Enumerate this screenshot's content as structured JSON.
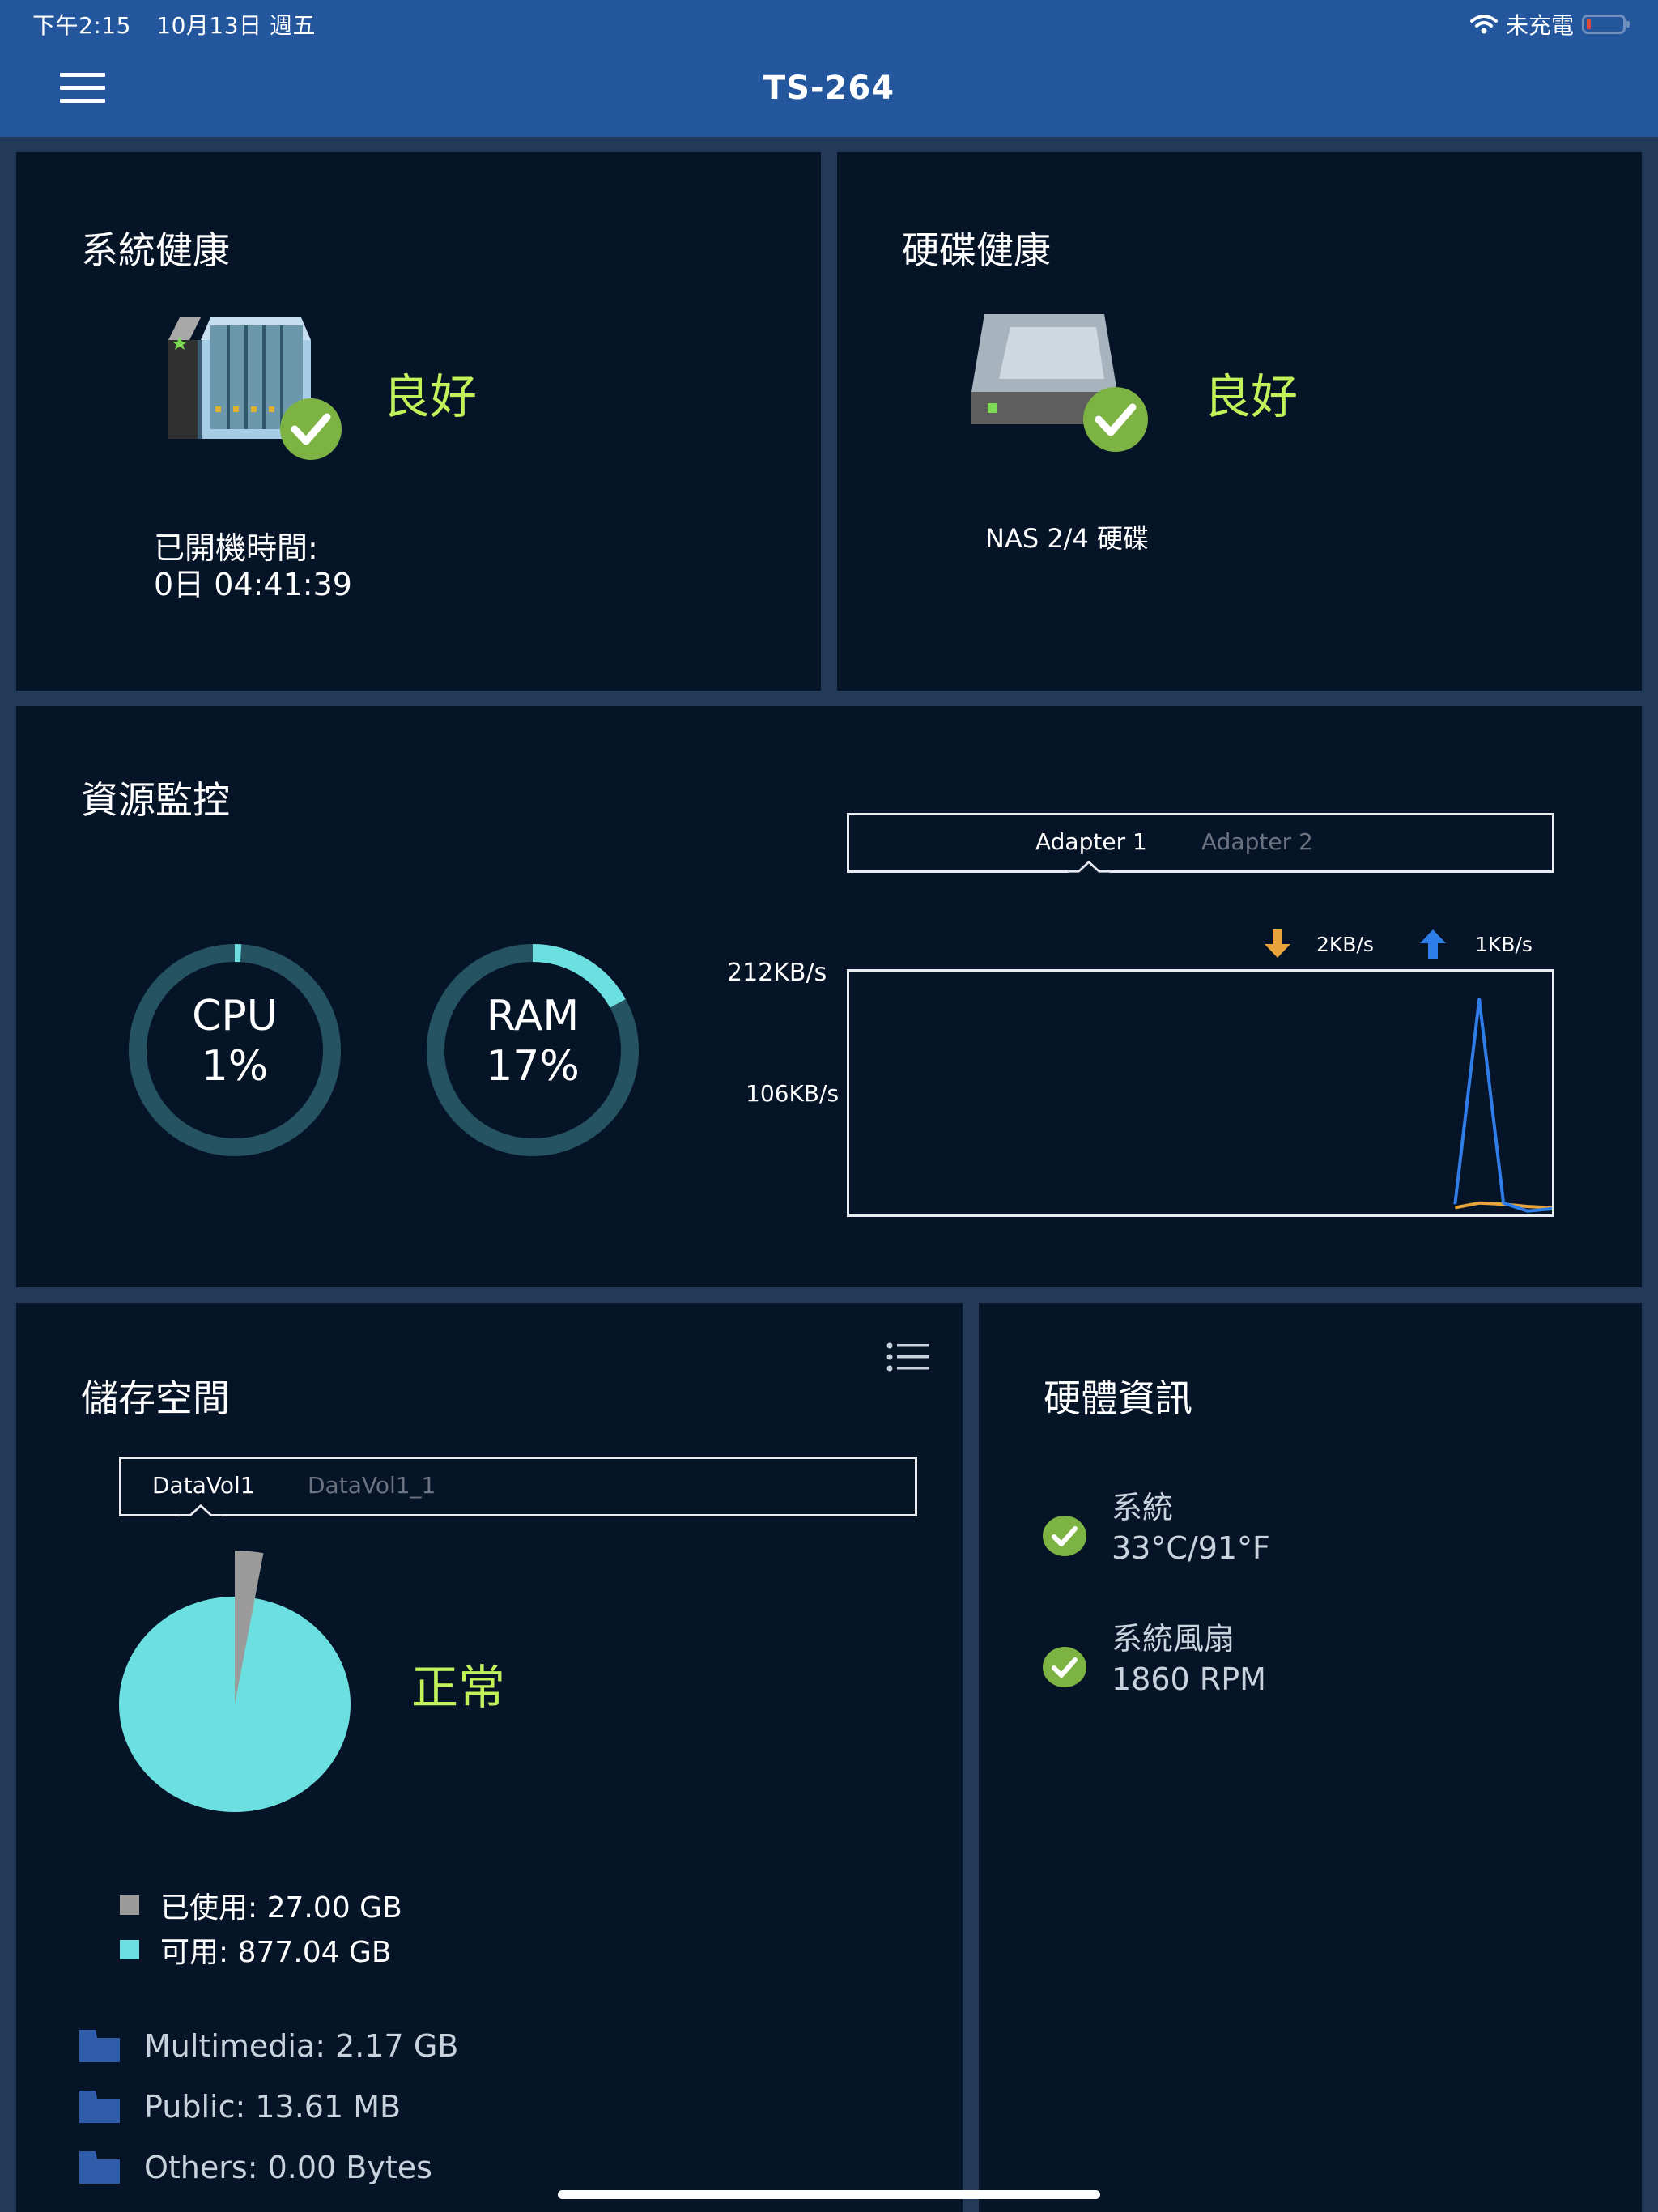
{
  "status_bar": {
    "time": "下午2:15",
    "date": "10月13日 週五",
    "charging_status": "未充電",
    "icons": [
      "wifi-icon",
      "battery-icon"
    ]
  },
  "header": {
    "title": "TS-264",
    "menu_icon": "hamburger-menu-icon"
  },
  "system_health": {
    "title": "系統健康",
    "status": "良好",
    "uptime_label": "已開機時間:",
    "uptime_value": "0日 04:41:39",
    "icon": "nas-device-icon"
  },
  "disk_health": {
    "title": "硬碟健康",
    "status": "良好",
    "disk_count": "NAS 2/4 硬碟",
    "icon": "hard-drive-icon"
  },
  "resource_monitor": {
    "title": "資源監控",
    "cpu": {
      "label": "CPU",
      "value_text": "1%",
      "percent": 1
    },
    "ram": {
      "label": "RAM",
      "value_text": "17%",
      "percent": 17
    },
    "adapter_tabs": [
      {
        "label": "Adapter 1",
        "active": true
      },
      {
        "label": "Adapter 2",
        "active": false
      }
    ],
    "download_rate": "2KB/s",
    "upload_rate": "1KB/s",
    "colors": {
      "download": "#e8a33d",
      "upload": "#2f7de8",
      "ring_track": "#265361",
      "ring_fill": "#6ce0e0"
    }
  },
  "chart_data": {
    "type": "line",
    "title": "",
    "xlabel": "",
    "ylabel": "",
    "ylim": [
      0,
      212
    ],
    "y_tick_labels": [
      "212KB/s",
      "106KB/s"
    ],
    "y_ticks": [
      212,
      106
    ],
    "x": [
      0,
      1,
      2,
      3,
      4,
      5,
      6,
      7,
      8,
      9,
      10,
      11,
      12,
      13,
      14,
      15,
      16,
      17,
      18,
      19,
      20,
      21,
      22,
      23,
      24,
      25,
      26,
      27,
      28,
      29
    ],
    "x_visible_from": 25,
    "series": [
      {
        "name": "download",
        "color": "#e8a33d",
        "values": [
          null,
          null,
          null,
          null,
          null,
          null,
          null,
          null,
          null,
          null,
          null,
          null,
          null,
          null,
          null,
          null,
          null,
          null,
          null,
          null,
          null,
          null,
          null,
          null,
          null,
          6,
          10,
          9,
          7,
          6
        ]
      },
      {
        "name": "upload",
        "color": "#2f7de8",
        "values": [
          null,
          null,
          null,
          null,
          null,
          null,
          null,
          null,
          null,
          null,
          null,
          null,
          null,
          null,
          null,
          null,
          null,
          null,
          null,
          null,
          null,
          null,
          null,
          null,
          null,
          9,
          188,
          10,
          3,
          5
        ]
      }
    ],
    "legend": "top-right",
    "grid": false
  },
  "storage": {
    "title": "儲存空間",
    "list_icon": "list-icon",
    "volume_tabs": [
      {
        "label": "DataVol1",
        "active": true
      },
      {
        "label": "DataVol1_1",
        "active": false
      }
    ],
    "status": "正常",
    "used_label": "已使用: 27.00 GB",
    "free_label": "可用: 877.04 GB",
    "used_gb": 27.0,
    "free_gb": 877.04,
    "colors": {
      "used": "#9b9b9b",
      "free": "#6ce0e0"
    },
    "folders": [
      {
        "label": "Multimedia: 2.17 GB"
      },
      {
        "label": "Public: 13.61 MB"
      },
      {
        "label": "Others: 0.00 Bytes"
      }
    ]
  },
  "hardware_info": {
    "title": "硬體資訊",
    "items": [
      {
        "name": "系統",
        "value": "33°C/91°F",
        "status": "ok"
      },
      {
        "name": "系統風扇",
        "value": "1860 RPM",
        "status": "ok"
      }
    ]
  }
}
